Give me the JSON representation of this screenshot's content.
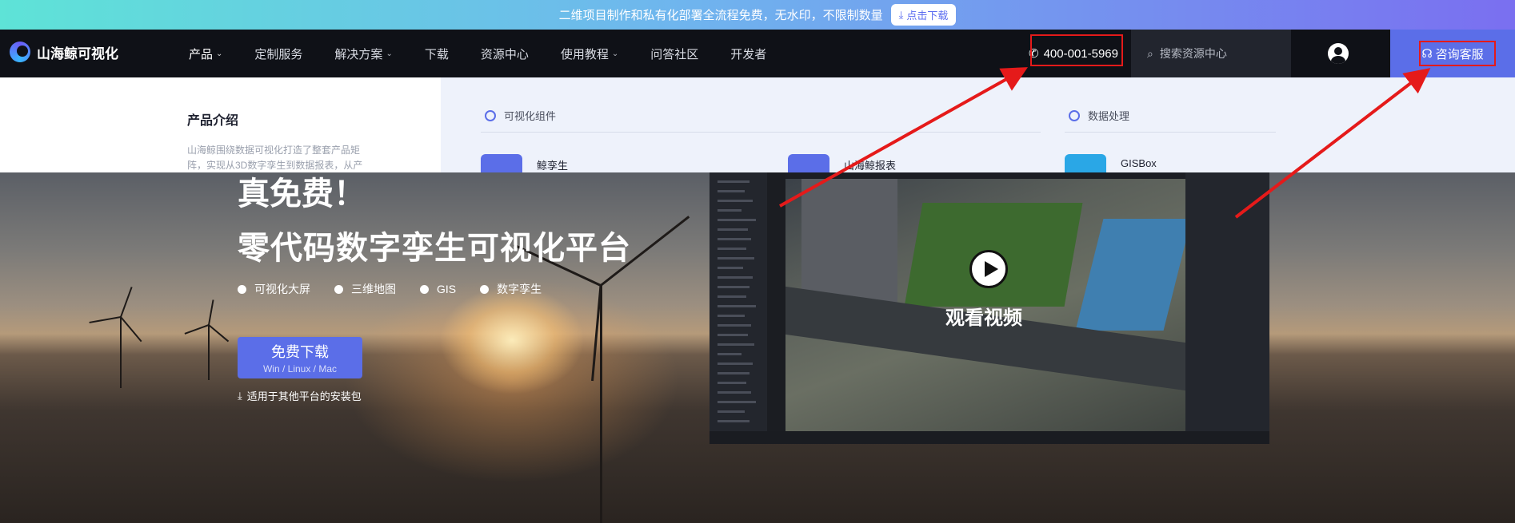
{
  "banner": {
    "text": "二维项目制作和私有化部署全流程免费，无水印，不限制数量",
    "button_label": "点击下载",
    "colors": {
      "gradient_start": "#5ee3d7",
      "gradient_end": "#7a6ff0"
    }
  },
  "nav": {
    "logo_text": "山海鲸可视化",
    "items": [
      {
        "label": "产品",
        "has_dropdown": true
      },
      {
        "label": "定制服务",
        "has_dropdown": false
      },
      {
        "label": "解决方案",
        "has_dropdown": true
      },
      {
        "label": "下载",
        "has_dropdown": false
      },
      {
        "label": "资源中心",
        "has_dropdown": false
      },
      {
        "label": "使用教程",
        "has_dropdown": true
      },
      {
        "label": "问答社区",
        "has_dropdown": false
      },
      {
        "label": "开发者",
        "has_dropdown": false
      }
    ],
    "phone": "400-001-5969",
    "search_placeholder": "搜索资源中心",
    "consult_label": "咨询客服",
    "accent": "#5b6ee8"
  },
  "dropdown": {
    "title": "产品介绍",
    "description": "山海鲸围绕数据可视化打造了整套产品矩阵，实现从3D数字孪生到数据报表，从产",
    "sections": [
      {
        "label": "可视化组件"
      },
      {
        "label": "数据处理"
      }
    ],
    "products": [
      {
        "name": "鲸孪生",
        "color": "#5b6ee8"
      },
      {
        "name": "山海鲸报表",
        "color": "#5b6ee8"
      },
      {
        "name": "GISBox",
        "color": "#2aa7e6"
      }
    ]
  },
  "hero": {
    "title_partial": "真免费！",
    "title": "零代码数字孪生可视化平台",
    "features": [
      "可视化大屏",
      "三维地图",
      "GIS",
      "数字孪生"
    ],
    "download_button": {
      "label": "免费下载",
      "sub": "Win / Linux / Mac"
    },
    "other_platforms": "适用于其他平台的安装包",
    "video_label": "观看视频"
  }
}
